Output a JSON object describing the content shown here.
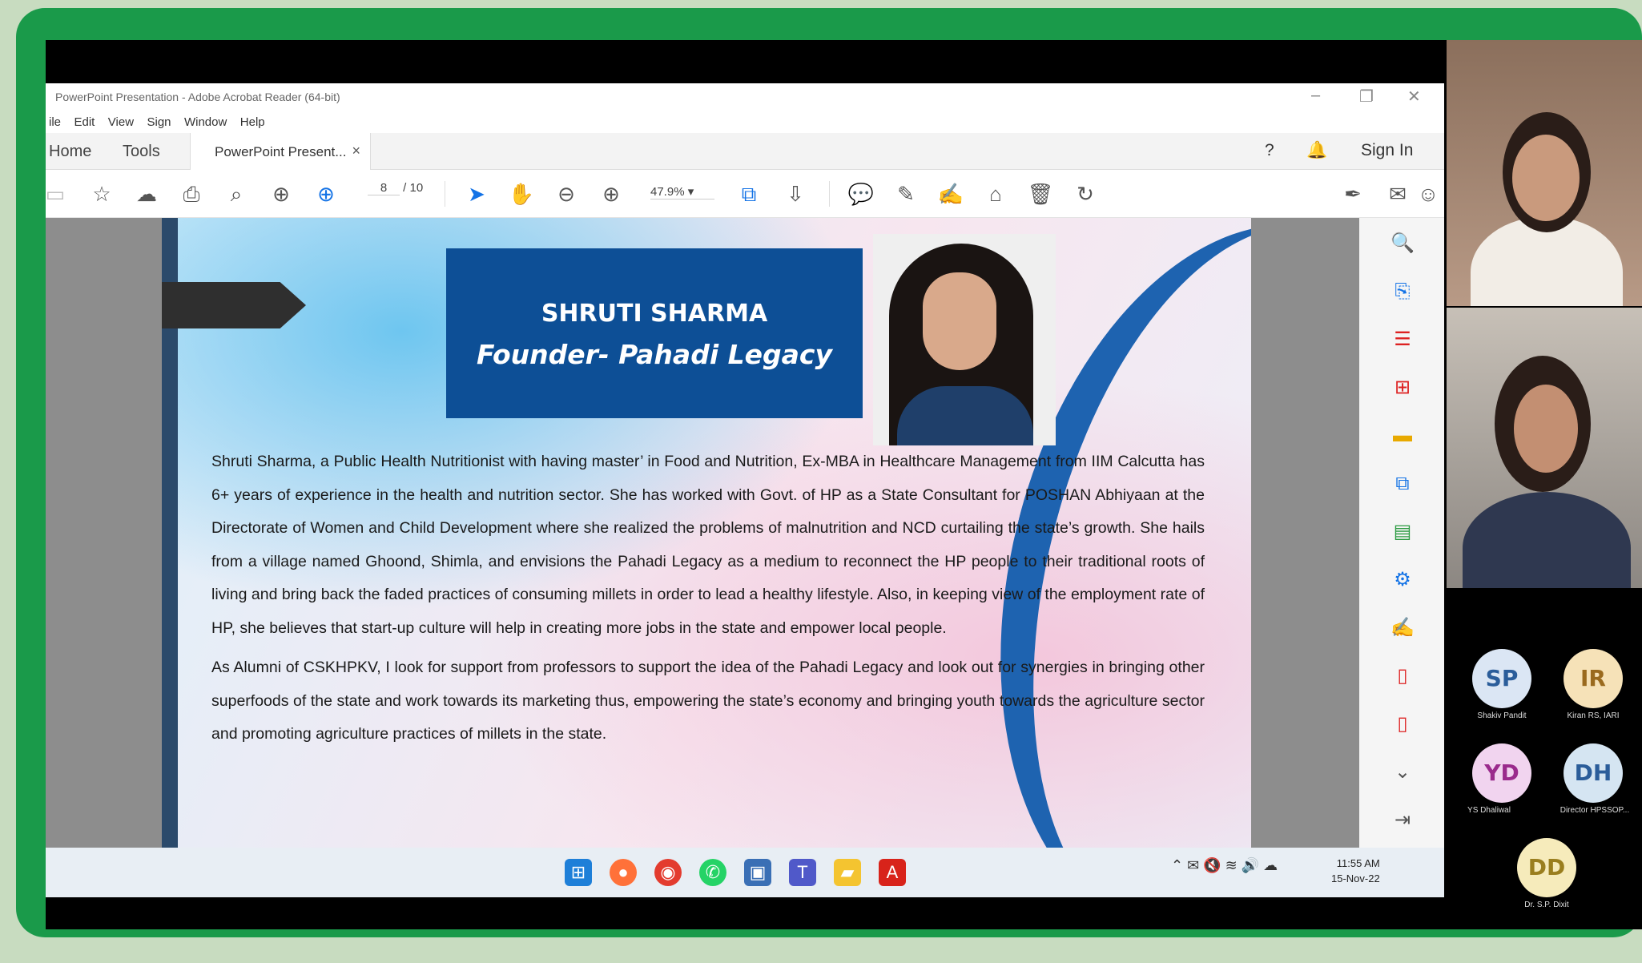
{
  "window": {
    "title": "PowerPoint Presentation - Adobe Acrobat Reader (64-bit)",
    "menu": [
      "ile",
      "Edit",
      "View",
      "Sign",
      "Window",
      "Help"
    ]
  },
  "tabs": {
    "home": "Home",
    "tools": "Tools",
    "document": "PowerPoint Present...",
    "close": "×",
    "sign_in": "Sign In"
  },
  "toolbar": {
    "page_current": "8",
    "page_total": "/ 10",
    "zoom": "47.9%"
  },
  "slide": {
    "name": "SHRUTI SHARMA",
    "role": "Founder- Pahadi Legacy",
    "paragraph1": "Shruti Sharma, a Public Health Nutritionist with having master’ in Food and Nutrition, Ex-MBA in Healthcare Management from IIM Calcutta has 6+ years of experience in the health and nutrition sector. She has worked with Govt. of HP as a State Consultant for POSHAN Abhiyaan at the Directorate of Women and Child Development where she realized the problems of malnutrition and NCD curtailing the state’s growth. She hails from a village named Ghoond, Shimla, and envisions the Pahadi Legacy as a medium to reconnect the HP people to their traditional roots of living and bring back the faded practices of consuming millets in order to lead a healthy lifestyle. Also, in keeping view of the employment rate of HP, she believes that start-up culture will help in creating more jobs in the state and empower local people.",
    "paragraph2": "As Alumni of CSKHPKV, I look for support from professors to support the idea of the Pahadi Legacy and look out for synergies in bringing other superfoods of the state and work towards its marketing thus, empowering the state’s economy and bringing youth towards the agriculture sector and promoting agriculture practices of millets in the state."
  },
  "clock": {
    "time": "11:55 AM",
    "date": "15-Nov-22"
  },
  "participants": [
    {
      "initials": "SP",
      "name": "Shakiv Pandit",
      "bg": "#dbe6f4",
      "fg": "#2b5d9a"
    },
    {
      "initials": "IR",
      "name": "Kiran RS, IARI",
      "bg": "#f6e2b8",
      "fg": "#9a6a1e"
    },
    {
      "initials": "YD",
      "name": "YS Dhaliwal",
      "bg": "#f1d4ef",
      "fg": "#9a2b8c"
    },
    {
      "initials": "DH",
      "name": "Director HPSSOP...",
      "bg": "#d5e5f2",
      "fg": "#2b5d9a"
    },
    {
      "initials": "DD",
      "name": "Dr. S.P. Dixit",
      "bg": "#f6ebbb",
      "fg": "#9a7e1e"
    }
  ],
  "colors": {
    "frame": "#1a9a4a",
    "name_box": "#0d4f96",
    "acrobat_accent": "#1473e6"
  }
}
